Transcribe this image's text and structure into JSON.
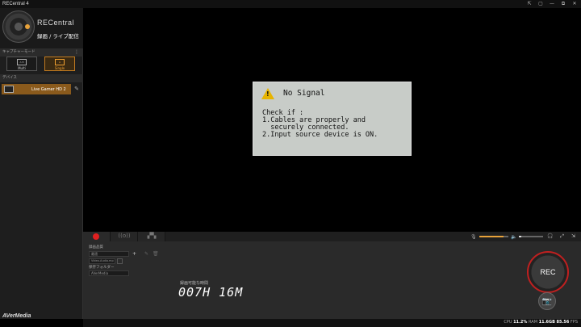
{
  "window": {
    "title": "RECentral 4",
    "controls": [
      "⇱",
      "▢",
      "—",
      "⧉",
      "✕"
    ]
  },
  "sidebar": {
    "logo_text": "RECentral",
    "subtitle": "録画 / ライブ配信",
    "capture_mode_header": "キャプチャーモード",
    "modes": [
      {
        "label": "Multi",
        "icon_text": "A B"
      },
      {
        "label": "Single",
        "icon_text": "A"
      }
    ],
    "device_header": "デバイス",
    "device_name": "Live Gamer HD 2",
    "brand": "AVerMedia"
  },
  "preview": {
    "signal": {
      "heading": "No Signal",
      "body": "Check if :\n1.Cables are properly and\n  securely connected.\n2.Input source device is ON."
    }
  },
  "bottom": {
    "tabs": [
      {
        "name": "record",
        "symbol": ""
      },
      {
        "name": "stream",
        "symbol": "((o))"
      },
      {
        "name": "multi",
        "symbol": "▞▚"
      }
    ],
    "record_settings_label": "録画品質",
    "quality_value": "最適",
    "format_value": "Video-Audio.mp",
    "folder_label": "保存フォルダー",
    "folder_value": "AVerMedia",
    "remaining_label": "録画可能な時間",
    "remaining_value": "007H 16M",
    "rec_label": "REC",
    "snapshot_icon": "📷",
    "mic_volume": 0.85,
    "speaker_volume": 0.1
  },
  "status": {
    "cpu_label": "CPU",
    "cpu_value": "11.2%",
    "ram_label": "RAM",
    "ram_value": "11.6GB",
    "fps_value": "85.56",
    "fps_label": "FPS"
  },
  "accent": "#e8a23a",
  "rec_color": "#e02020"
}
